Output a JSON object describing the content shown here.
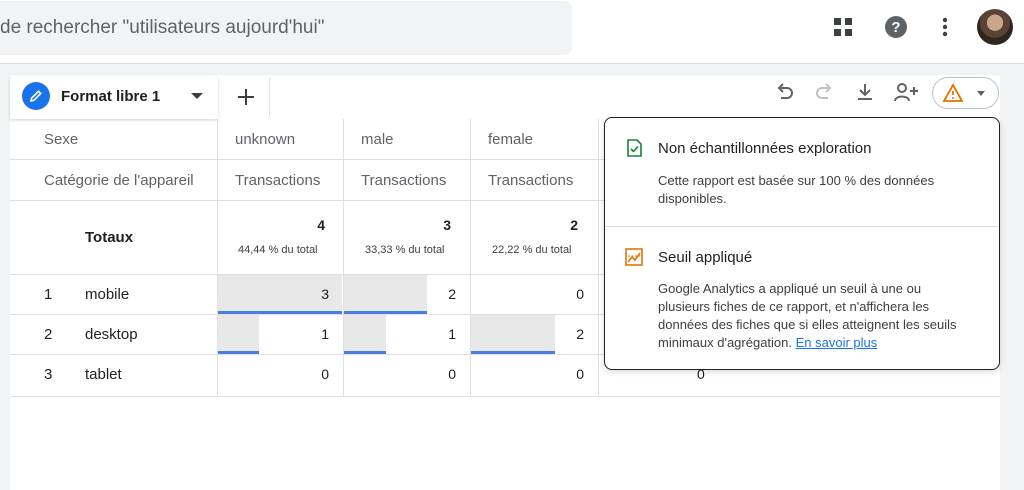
{
  "search": {
    "placeholder_text": "de rechercher \"utilisateurs aujourd'hui\""
  },
  "tab": {
    "label": "Format libre 1"
  },
  "table": {
    "row_dimension_header": "Sexe",
    "col_metric_header": "Catégorie de l'appareil",
    "columns": [
      {
        "dim": "unknown",
        "metric": "Transactions",
        "total": "4",
        "pct": "44,44 % du total"
      },
      {
        "dim": "male",
        "metric": "Transactions",
        "total": "3",
        "pct": "33,33 % du total"
      },
      {
        "dim": "female",
        "metric": "Transactions",
        "total": "2",
        "pct": "22,22 % du total"
      }
    ],
    "totals_label": "Totaux",
    "rows": [
      {
        "index": "1",
        "label": "mobile",
        "values": [
          "3",
          "2",
          "0"
        ],
        "fractions": [
          1.0,
          0.667,
          0.0
        ]
      },
      {
        "index": "2",
        "label": "desktop",
        "values": [
          "1",
          "1",
          "2"
        ],
        "fractions": [
          0.333,
          0.333,
          0.667
        ]
      },
      {
        "index": "3",
        "label": "tablet",
        "values": [
          "0",
          "0",
          "0"
        ],
        "fractions": [
          0.0,
          0.0,
          0.0
        ]
      }
    ],
    "hidden_col_partial": "0"
  },
  "popup": {
    "section1": {
      "title": "Non échantillonnées exploration",
      "text": "Cette rapport est basée sur 100 % des données disponibles."
    },
    "section2": {
      "title": "Seuil appliqué",
      "text": "Google Analytics a appliqué un seuil à une ou plusieurs fiches de ce rapport, et n'affichera les données des fiches que si elles atteignent les seuils minimaux d'agrégation.",
      "link": "En savoir plus"
    }
  },
  "colors": {
    "accent": "#1a73e8",
    "bar": "#4a7fe0",
    "check": "#188038",
    "warning": "#e37400"
  }
}
